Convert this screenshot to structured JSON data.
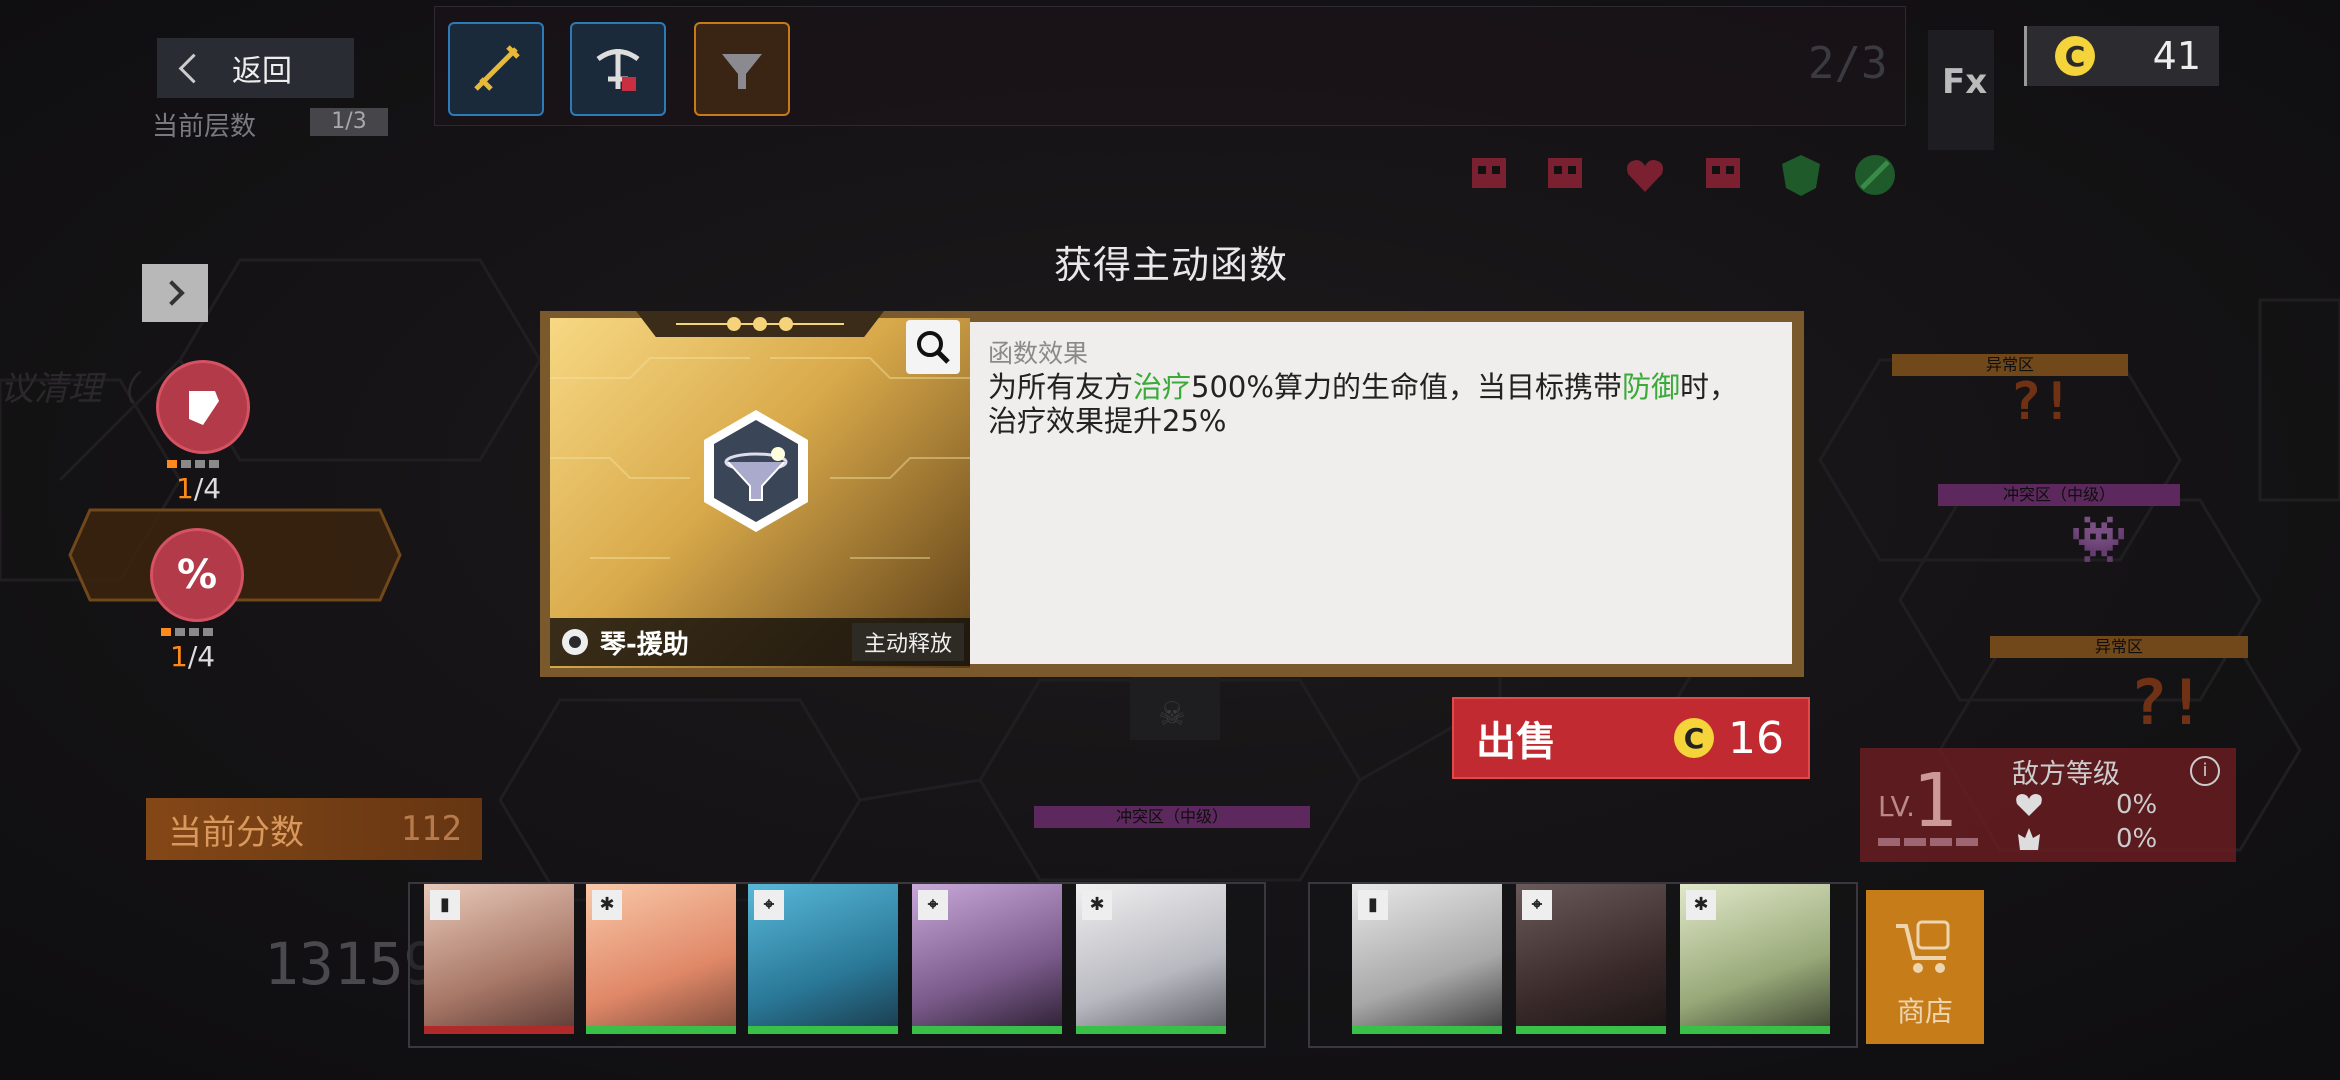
{
  "header": {
    "back_label": "返回",
    "floor_label": "当前层数",
    "floor_value": "1/3",
    "stage_progress": "2/3",
    "fx_label": "Fx",
    "coins": "41"
  },
  "sidebar": {
    "badge_1_count_current": "1",
    "badge_1_count_total": "/4",
    "badge_2_symbol": "%",
    "badge_2_count_current": "1",
    "badge_2_count_total": "/4",
    "partial_map_text": "议清理（",
    "score_label": "当前分数",
    "score_value": "112",
    "total_score": "13159"
  },
  "map": {
    "zone_labels": [
      "异常区",
      "冲突区（中级）",
      "异常区",
      "冲突区（中级）"
    ],
    "mystery_glyph": "?!"
  },
  "dialog": {
    "title": "获得主动函数",
    "card_name": "琴-援助",
    "card_tag": "主动释放",
    "effect_heading": "函数效果",
    "effect_line1_pre": "为所有友方",
    "effect_kw1": "治疗",
    "effect_line1_mid": "500%算力的生命值，当目标携带",
    "effect_kw2": "防御",
    "effect_line1_post": "时，",
    "effect_line2": "治疗效果提升25%",
    "sell_label": "出售",
    "sell_price": "16",
    "highlight_color": "#3aaa3a"
  },
  "enemy": {
    "lv_prefix": "LV.",
    "level": "1",
    "title": "敌方等级",
    "hp_bonus": "0%",
    "atk_bonus": "0%"
  },
  "shop": {
    "label": "商店"
  },
  "team": {
    "left": [
      "defender",
      "support",
      "sniper",
      "sniper",
      "support"
    ],
    "right": [
      "defender",
      "sniper",
      "support"
    ]
  }
}
